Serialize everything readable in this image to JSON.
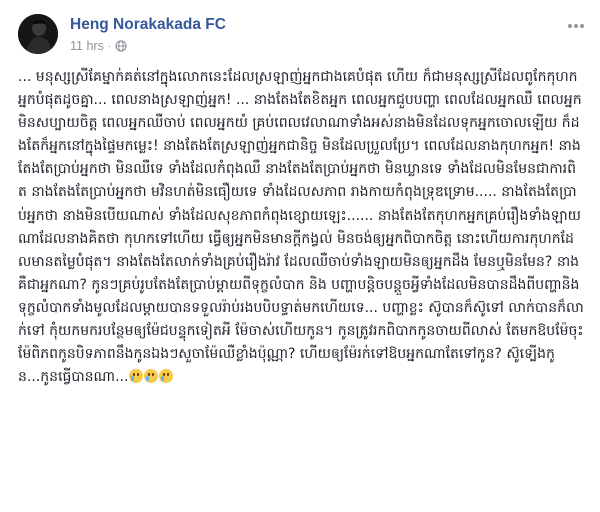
{
  "post": {
    "author": "Heng Norakakada FC",
    "timestamp": "11 hrs",
    "separator": "·",
    "privacy_icon": "globe-icon",
    "more_icon": "more-options-icon",
    "avatar_icon": "profile-avatar-icon",
    "author_color": "#365899",
    "body_text": "... មនុស្សស្រីគែម្នាក់គត់នៅក្នុងលោកនេះដែលស្រឡាញ់អ្នកជាងគេបំផុត ហើយ ក៏ជាមនុស្សស្រីដែលពូកែកុហកអ្នកបំផុតដូចគ្នា... ពេលនាងស្រឡាញ់អ្នក! ... នាងតែងតែខិតអ្នក ពេលអ្នកជួបបញ្ហា ពេលដែលអ្នកឈឺ ពេលអ្នកមិនសប្បាយចិត្ត ពេលអ្នកឈឺចាប់ ពេលអ្នកយំ គ្រប់ពេលវេលាណាទាំងអស់នាងមិនដែលទុកអ្នកចោលឡើយ ក៏ដងតែក៏អ្នកនៅក្នុងផ្ទៃមកម្លេះ! នាងតែងតែស្រឡាញ់អ្នកជានិច្ច មិនដែលប្រួលប្រែ។ ពេលដែលនាងកុហកអ្នក! នាងតែងតែប្រាប់អ្នកថា មិនឈឺទេ ទាំងដែលកំពុងឈឺ នាងតែងតែប្រាប់អ្នកថា មិនឃ្លានទេ ទាំងដែលមិនមែនជាការពិត នាងតែងតែប្រាប់អ្នកថា មវិនហត់មិនធឿយទេ ទាំងដែលសភាព រាងកាយកំពុងទ្រុឌទ្រោម..... នាងតែងតែប្រាប់អ្នកថា នាងមិនបើយណាស់ ទាំងដែលសុខភាពកំពុងខ្សោយឡេះ...... នាងតែងតែកុហកអ្នកគ្រប់រឿងទាំងឡាយណាដែលនាងគិតថា កុហកទៅហើយ ធ្វើឲ្យអ្នកមិនមានក្តីកង្វល់ មិនចង់ឲ្យអ្នកពិបាកចិត្ត នោះហើយការកុហកដែលមានតម្លៃបំផុត។ នាងតែងតែលាក់ទាំងគ្រប់រឿងរ៉ាវ ដែលឈឺចាប់ទាំងឡាយមិនឲ្យអ្នកដឹង មែនឬមិនមែន? នាងគឺជាអ្នកណា? កូនៗគ្រប់រូបតែងតែប្រាប់ម្តាយពីទុក្ខលំបាក និង បញ្ហាបន្តិចបន្តួចអ្វីទាំងដែលមិនបានដឹងពីបញ្ហានិងទុក្ខលំបាកទាំងមូលដែលម្តាយបានទទួលរ៉ាប់រងបបិបទ្ធាត់មកហើយទេ... បញ្ហាខ្លះ ស៊ូបានក៏ស៊ូទៅ លាក់បានក៏លាក់ទៅ កុំយកមករបន្ថែមឲ្យម៉ែជបន្ទុកទៀតអី ម៉ែចាស់ហើយកូន។ កូនត្រូវរកពិបាកកូនចាយពីលាស់ តែមកឱបម៉ែចុះម៉ែពិភពកូនបិទភាពនឹងកូនឯងៗសួចាម៉ែឈឺខ្លាំងប៉ុណ្ណា? ហើយឲ្យម៉ែរក់ទៅឱបអ្នកណាតែទៅកូន? ស៊ូទ្បើងកូន...កូនធ្វើបានណា...",
    "emoji_count": 3,
    "emoji_icon": "crying-face-emoji-icon"
  }
}
